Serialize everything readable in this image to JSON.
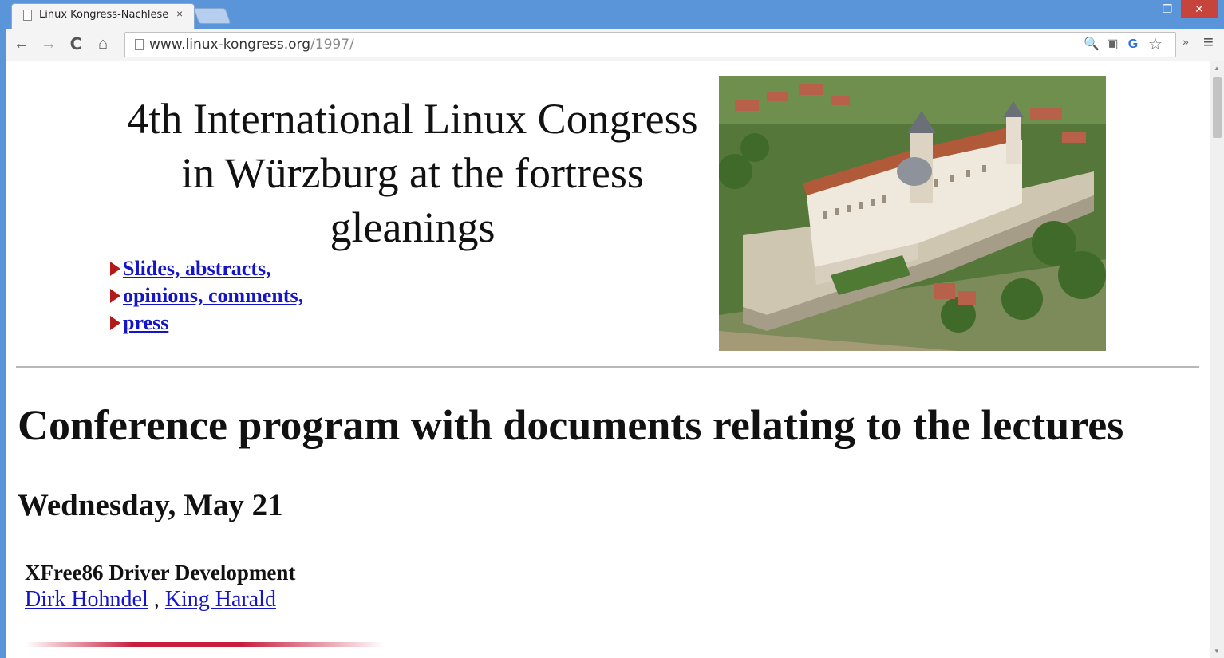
{
  "browser": {
    "tab_title": "Linux Kongress-Nachlese ",
    "tab_close": "×",
    "url_host": "www.linux-kongress.org",
    "url_path": "/1997/",
    "win_min": "–",
    "win_max": "❐",
    "win_close": "✕",
    "icons": {
      "back": "←",
      "forward": "→",
      "reload": "C",
      "home": "⌂",
      "zoom": "🔍",
      "ext1": "▣",
      "ext2": "G",
      "star": "☆",
      "more": "»",
      "menu": "≡"
    }
  },
  "page": {
    "hero_title_line1": "4th International Linux Congress",
    "hero_title_line2": "in Würzburg at the fortress",
    "hero_title_line3": "gleanings",
    "links": [
      {
        "label": "Slides, abstracts, "
      },
      {
        "label": "opinions, comments, "
      },
      {
        "label": "press"
      }
    ],
    "heading": "Conference program with documents relating to the lectures",
    "day": "Wednesday, May 21",
    "talk": {
      "title": "XFree86 Driver Development",
      "speaker1": "Dirk Hohndel",
      "separator": " , ",
      "speaker2": "King Harald"
    }
  },
  "colors": {
    "chrome_blue": "#5a94d9",
    "link": "#1414c8",
    "arrow": "#b21a1a"
  }
}
